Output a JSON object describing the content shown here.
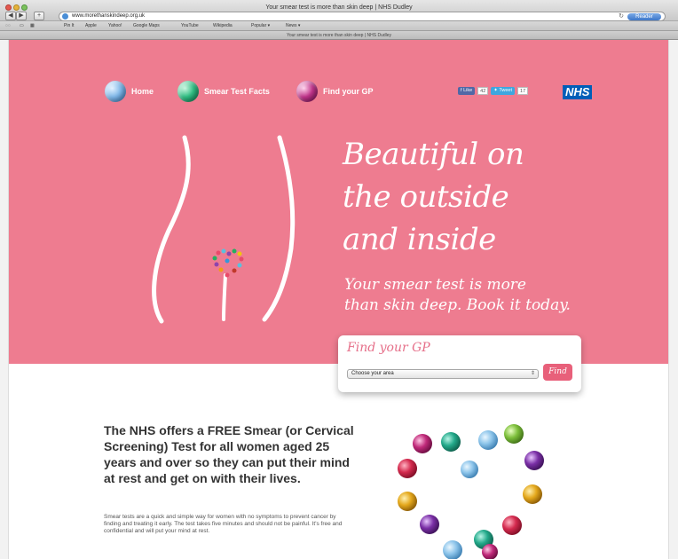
{
  "browser": {
    "window_title": "Your smear test is more than skin deep | NHS Dudley",
    "url": "www.morethanskindeep.org.uk",
    "reader_label": "Reader",
    "bookmarks": [
      "Pin It",
      "Apple",
      "Yahoo!",
      "Google Maps",
      "YouTube",
      "Wikipedia",
      "Popular ▾",
      "News ▾"
    ],
    "tab_title": "Your smear test is more than skin deep | NHS Dudley"
  },
  "nav": {
    "home": "Home",
    "facts": "Smear Test Facts",
    "find_gp": "Find your GP"
  },
  "social": {
    "like_label": "Like",
    "like_count": "42",
    "tweet_label": "Tweet",
    "tweet_count": "17"
  },
  "logo": "NHS",
  "hero": {
    "headline_1": "Beautiful on",
    "headline_2": "the outside",
    "headline_3": "and inside",
    "subline_1": "Your smear test is more",
    "subline_2": "than skin deep. Book it today."
  },
  "find_gp_box": {
    "title": "Find your GP",
    "select_value": "Choose your area",
    "button_label": "Find"
  },
  "intro": {
    "heading": "The NHS offers a FREE Smear (or Cervical Screening) Test for all women aged 25 years and over so they can put their mind at rest and get on with their lives.",
    "body": "Smear tests are a quick and simple way for women with no symptoms to prevent cancer by finding and treating it early. The test takes five minutes and should not be painful. It's free and confidential and will put your mind at rest."
  },
  "colors": {
    "hero_pink": "#ee7c90",
    "nhs_blue": "#005eb8",
    "button_pink": "#e8607a"
  }
}
